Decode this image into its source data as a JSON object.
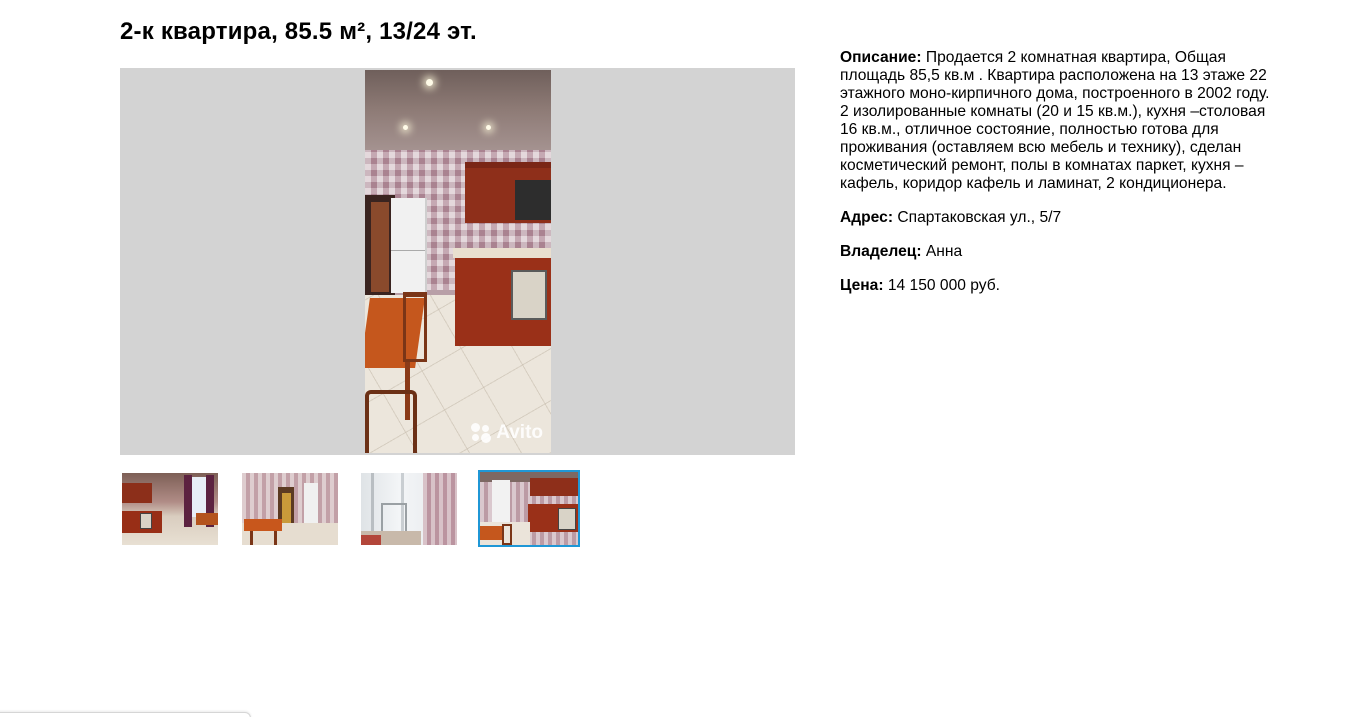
{
  "listing": {
    "title": "2-к квартира, 85.5 м², 13/24 эт."
  },
  "gallery": {
    "watermark": "Avito",
    "thumbnails": [
      {
        "name": "thumb-kitchen-window",
        "selected": false
      },
      {
        "name": "thumb-room-table",
        "selected": false
      },
      {
        "name": "thumb-balcony",
        "selected": false
      },
      {
        "name": "thumb-kitchen-fridge",
        "selected": true
      }
    ],
    "highlight_color": "#1f97d6"
  },
  "details": {
    "description_label": "Описание:",
    "description_text": " Продается 2 комнатная квартира, Общая площадь 85,5 кв.м . Квартира расположена на 13 этаже 22 этажного моно-кирпичного дома, построенного в 2002 году. 2 изолированные комнаты (20 и 15 кв.м.), кухня –столовая 16 кв.м., отличное состояние, полностью готова для проживания (оставляем всю мебель и технику), сделан косметический ремонт, полы в комнатах паркет, кухня – кафель, коридор кафель и ламинат, 2 кондиционера.",
    "address_label": "Адрес:",
    "address_text": " Спартаковская ул., 5/7",
    "owner_label": "Владелец:",
    "owner_text": " Анна",
    "price_label": "Цена:",
    "price_text": " 14 150 000 руб."
  }
}
